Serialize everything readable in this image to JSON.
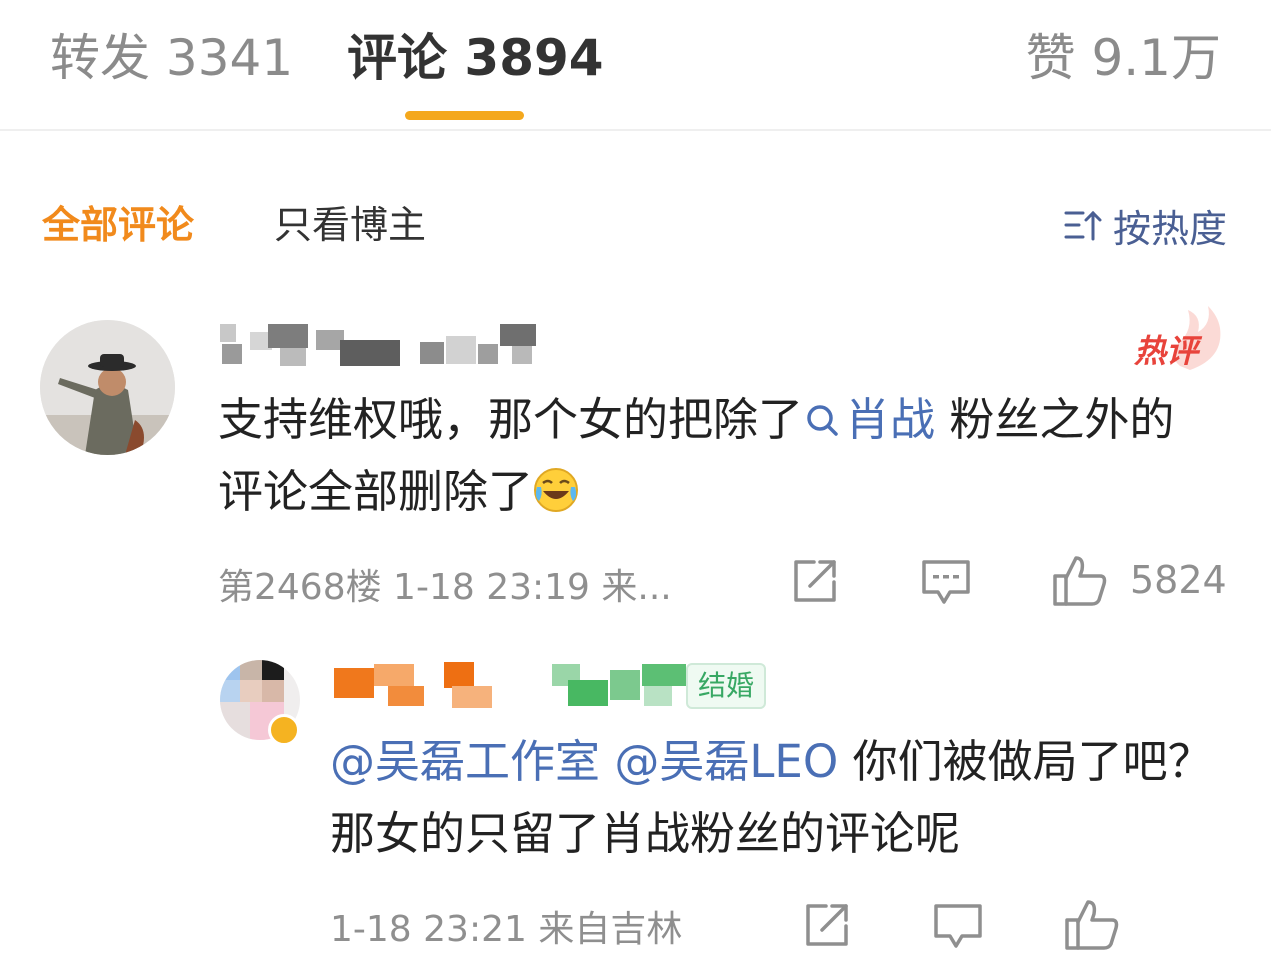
{
  "tabs": {
    "repost": "转发 3341",
    "comment": "评论 3894",
    "like": "赞 9.1万"
  },
  "filters": {
    "all": "全部评论",
    "blogger_only": "只看博主",
    "sort": "按热度"
  },
  "comment": {
    "hot_label": "热评",
    "text_before": "支持维权哦，那个女的把除了",
    "topic": "肖战",
    "text_after": " 粉丝之外的评论全部删除了",
    "emoji": "laugh-cry-emoji",
    "meta": "第2468楼 1-18 23:19 来...",
    "like_count": "5824"
  },
  "reply": {
    "badge": "结婚",
    "mention1": "@吴磊工作室",
    "mention2": "@吴磊LEO",
    "text": " 你们被做局了吧？那女的只留了肖战粉丝的评论呢",
    "meta": "1-18 23:21 来自吉林"
  },
  "colors": {
    "accent_orange": "#f18a1c",
    "tab_underline": "#f4a81d",
    "link_blue": "#4a6fb5",
    "hot_red": "#e8433b"
  }
}
